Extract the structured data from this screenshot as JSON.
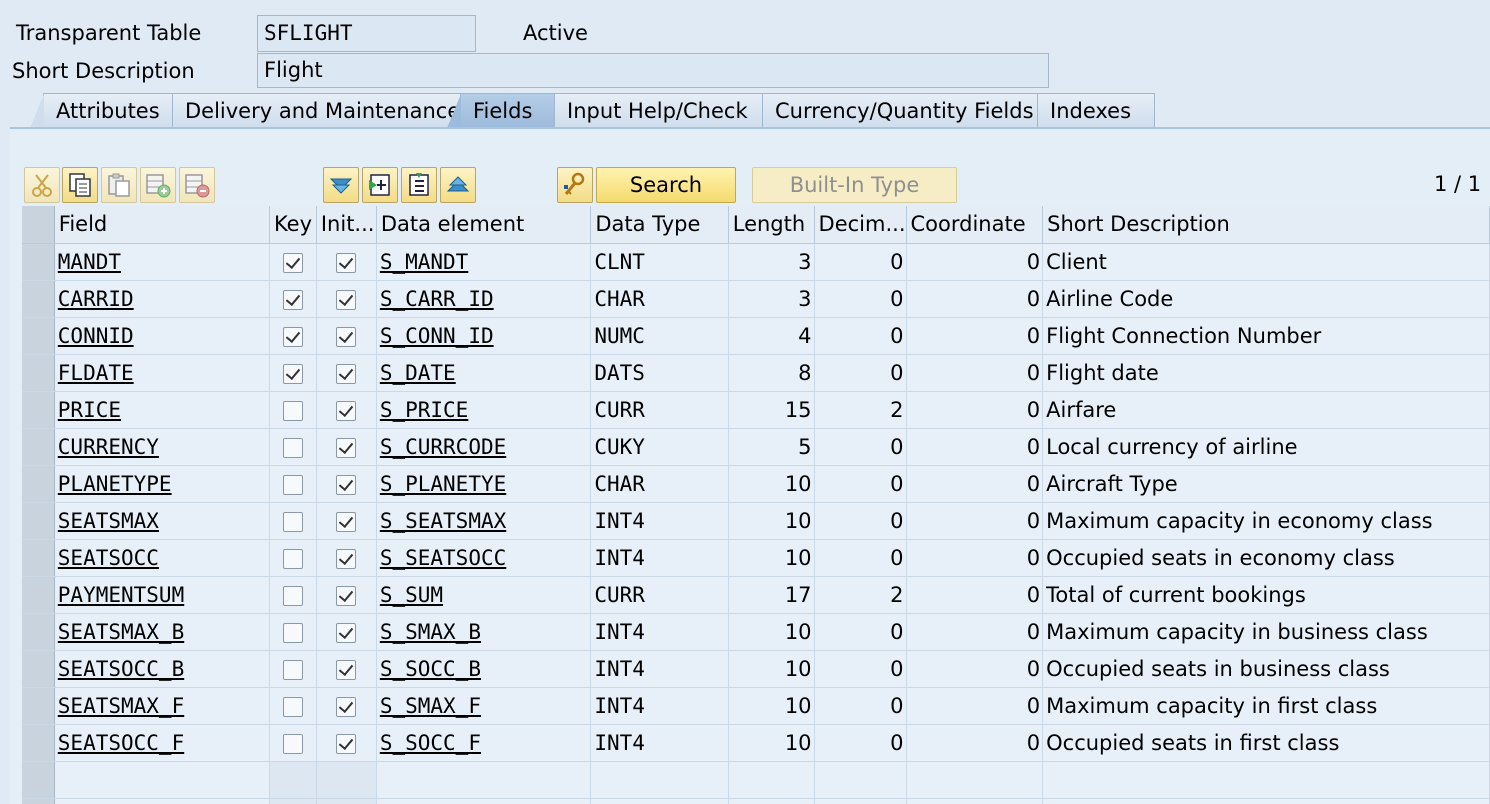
{
  "header": {
    "table_type_label": "Transparent Table",
    "table_name": "SFLIGHT",
    "status": "Active",
    "short_desc_label": "Short Description",
    "short_desc_value": "Flight"
  },
  "tabs": [
    {
      "label": "Attributes"
    },
    {
      "label": "Delivery and Maintenance"
    },
    {
      "label": "Fields",
      "active": true
    },
    {
      "label": "Input Help/Check"
    },
    {
      "label": "Currency/Quantity Fields"
    },
    {
      "label": "Indexes"
    }
  ],
  "toolbar": {
    "search_label": "Search",
    "builtin_label": "Built-In Type",
    "pager": "1 / 1",
    "icons": [
      "cut-icon",
      "copy-icon",
      "paste-icon",
      "insert-row-icon",
      "delete-row-icon",
      "scroll-bottom-icon",
      "scroll-next-icon",
      "scroll-prev-icon",
      "scroll-top-icon",
      "key-search-icon"
    ]
  },
  "columns": [
    "Field",
    "Key",
    "Init...",
    "Data element",
    "Data Type",
    "Length",
    "Decim...",
    "Coordinate",
    "Short Description"
  ],
  "rows": [
    {
      "field": "MANDT",
      "key": true,
      "init": true,
      "element": "S_MANDT",
      "type": "CLNT",
      "length": "3",
      "dec": "0",
      "coord": "0",
      "desc": "Client"
    },
    {
      "field": "CARRID",
      "key": true,
      "init": true,
      "element": "S_CARR_ID",
      "type": "CHAR",
      "length": "3",
      "dec": "0",
      "coord": "0",
      "desc": "Airline Code"
    },
    {
      "field": "CONNID",
      "key": true,
      "init": true,
      "element": "S_CONN_ID",
      "type": "NUMC",
      "length": "4",
      "dec": "0",
      "coord": "0",
      "desc": "Flight Connection Number"
    },
    {
      "field": "FLDATE",
      "key": true,
      "init": true,
      "element": "S_DATE",
      "type": "DATS",
      "length": "8",
      "dec": "0",
      "coord": "0",
      "desc": "Flight date"
    },
    {
      "field": "PRICE",
      "key": false,
      "init": true,
      "element": "S_PRICE",
      "type": "CURR",
      "length": "15",
      "dec": "2",
      "coord": "0",
      "desc": "Airfare"
    },
    {
      "field": "CURRENCY",
      "key": false,
      "init": true,
      "element": "S_CURRCODE",
      "type": "CUKY",
      "length": "5",
      "dec": "0",
      "coord": "0",
      "desc": "Local currency of airline"
    },
    {
      "field": "PLANETYPE",
      "key": false,
      "init": true,
      "element": "S_PLANETYE",
      "type": "CHAR",
      "length": "10",
      "dec": "0",
      "coord": "0",
      "desc": "Aircraft Type"
    },
    {
      "field": "SEATSMAX",
      "key": false,
      "init": true,
      "element": "S_SEATSMAX",
      "type": "INT4",
      "length": "10",
      "dec": "0",
      "coord": "0",
      "desc": "Maximum capacity in economy class"
    },
    {
      "field": "SEATSOCC",
      "key": false,
      "init": true,
      "element": "S_SEATSOCC",
      "type": "INT4",
      "length": "10",
      "dec": "0",
      "coord": "0",
      "desc": "Occupied seats in economy class"
    },
    {
      "field": "PAYMENTSUM",
      "key": false,
      "init": true,
      "element": "S_SUM",
      "type": "CURR",
      "length": "17",
      "dec": "2",
      "coord": "0",
      "desc": "Total of current bookings"
    },
    {
      "field": "SEATSMAX_B",
      "key": false,
      "init": true,
      "element": "S_SMAX_B",
      "type": "INT4",
      "length": "10",
      "dec": "0",
      "coord": "0",
      "desc": "Maximum capacity in business class"
    },
    {
      "field": "SEATSOCC_B",
      "key": false,
      "init": true,
      "element": "S_SOCC_B",
      "type": "INT4",
      "length": "10",
      "dec": "0",
      "coord": "0",
      "desc": "Occupied seats in business class"
    },
    {
      "field": "SEATSMAX_F",
      "key": false,
      "init": true,
      "element": "S_SMAX_F",
      "type": "INT4",
      "length": "10",
      "dec": "0",
      "coord": "0",
      "desc": "Maximum capacity in first class"
    },
    {
      "field": "SEATSOCC_F",
      "key": false,
      "init": true,
      "element": "S_SOCC_F",
      "type": "INT4",
      "length": "10",
      "dec": "0",
      "coord": "0",
      "desc": "Occupied seats in first class"
    }
  ]
}
